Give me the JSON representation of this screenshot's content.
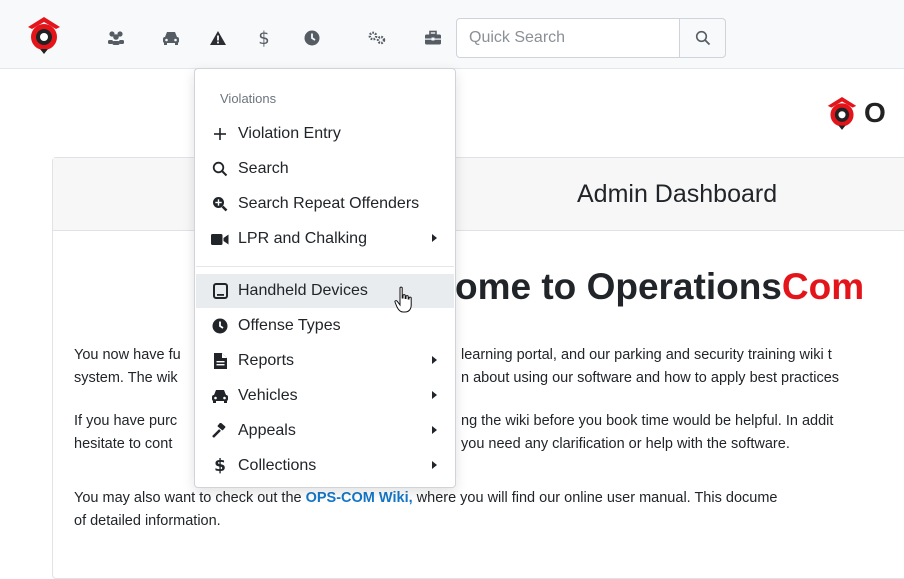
{
  "navbar": {
    "icons": [
      "logo-icon",
      "users-icon",
      "car-icon",
      "warning-icon",
      "dollar-icon",
      "clock-icon",
      "gears-icon",
      "toolbox-icon"
    ],
    "search": {
      "placeholder": "Quick Search",
      "value": ""
    }
  },
  "brand": {
    "text": "O"
  },
  "card": {
    "title": "Admin Dashboard"
  },
  "welcome": {
    "prefix": "ome to ",
    "name_black": "Operations",
    "name_red": "Com"
  },
  "paragraphs": {
    "p1_line1_a": "You now have fu",
    "p1_line1_b": "learning portal, and our parking and security training wiki t",
    "p1_line2_a": "system. The wik",
    "p1_line2_b": "n about using our software and how to apply best practices",
    "p2_line1_a": "If you have purc",
    "p2_line1_b": "ng the wiki before you book time would be helpful. In addit",
    "p2_line2_a": "hesitate to cont",
    "p2_line2_b": "you need any clarification or help with the software.",
    "p3_line1_a": "You may also want to check out the ",
    "p3_link": "OPS-COM Wiki,",
    "p3_line1_b": " where you will find our online user manual. This docume",
    "p3_line2": "of detailed information."
  },
  "dropdown": {
    "header": "Violations",
    "items": [
      {
        "label": "Violation Entry",
        "icon": "plus-icon",
        "submenu": false
      },
      {
        "label": "Search",
        "icon": "search-icon",
        "submenu": false
      },
      {
        "label": "Search Repeat Offenders",
        "icon": "search-plus-icon",
        "submenu": false
      },
      {
        "label": "LPR and Chalking",
        "icon": "video-icon",
        "submenu": true
      },
      {
        "label": "Handheld Devices",
        "icon": "tablet-icon",
        "submenu": false
      },
      {
        "label": "Offense Types",
        "icon": "clock-icon",
        "submenu": false
      },
      {
        "label": "Reports",
        "icon": "file-icon",
        "submenu": true
      },
      {
        "label": "Vehicles",
        "icon": "car-icon",
        "submenu": true
      },
      {
        "label": "Appeals",
        "icon": "gavel-icon",
        "submenu": true
      },
      {
        "label": "Collections",
        "icon": "dollar-icon",
        "submenu": true
      }
    ]
  },
  "colors": {
    "accent_red": "#e3151b",
    "link_blue": "#1477c9",
    "hover_bg": "#e9ecef"
  }
}
